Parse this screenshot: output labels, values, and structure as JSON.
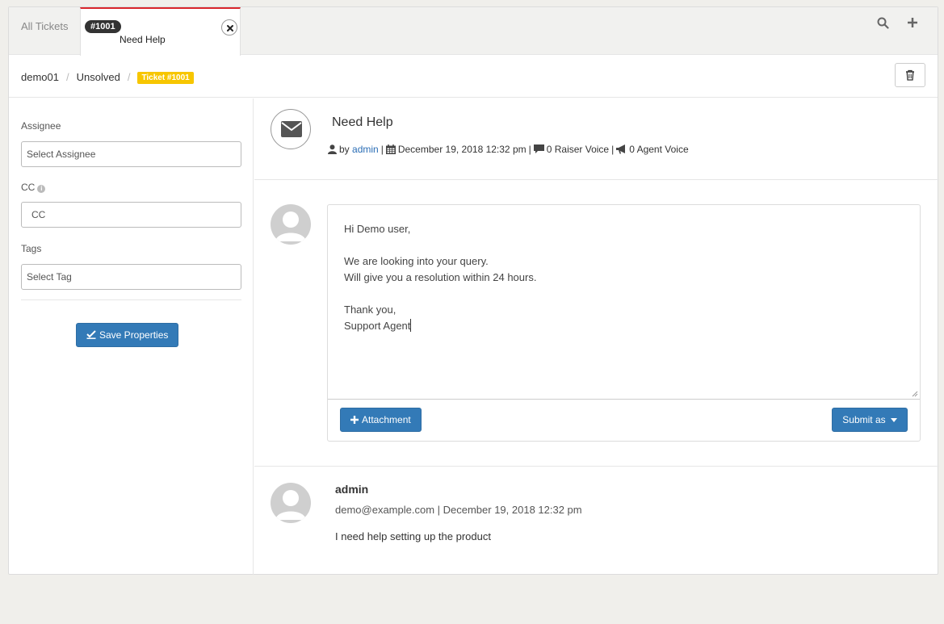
{
  "tabs": {
    "all_label": "All Tickets",
    "active_badge": "#1001",
    "active_title": "Need Help"
  },
  "breadcrumb": {
    "items": [
      "demo01",
      "Unsolved"
    ],
    "badge": "Ticket #1001"
  },
  "properties": {
    "assignee_label": "Assignee",
    "assignee_placeholder": "Select Assignee",
    "cc_label": "CC",
    "cc_placeholder": "CC",
    "tags_label": "Tags",
    "tags_placeholder": "Select Tag",
    "save_label": "Save Properties"
  },
  "ticket": {
    "title": "Need Help",
    "by_prefix": "by",
    "author": "admin",
    "date": "December 19, 2018 12:32 pm",
    "raiser_voice": "0 Raiser Voice",
    "agent_voice": "0 Agent Voice"
  },
  "reply": {
    "lines": [
      "Hi Demo user,",
      "",
      "We are looking into your query.",
      "Will give you a resolution within 24 hours.",
      "",
      "Thank you,",
      "Support Agent"
    ],
    "attachment_label": "Attachment",
    "submit_label": "Submit as"
  },
  "thread": {
    "author": "admin",
    "meta": "demo@example.com | December 19, 2018 12:32 pm",
    "message": "I need help setting up the product"
  },
  "colors": {
    "accent": "#337ab7",
    "active_tab_border": "#d9262b",
    "ticket_badge": "#f7c600"
  }
}
